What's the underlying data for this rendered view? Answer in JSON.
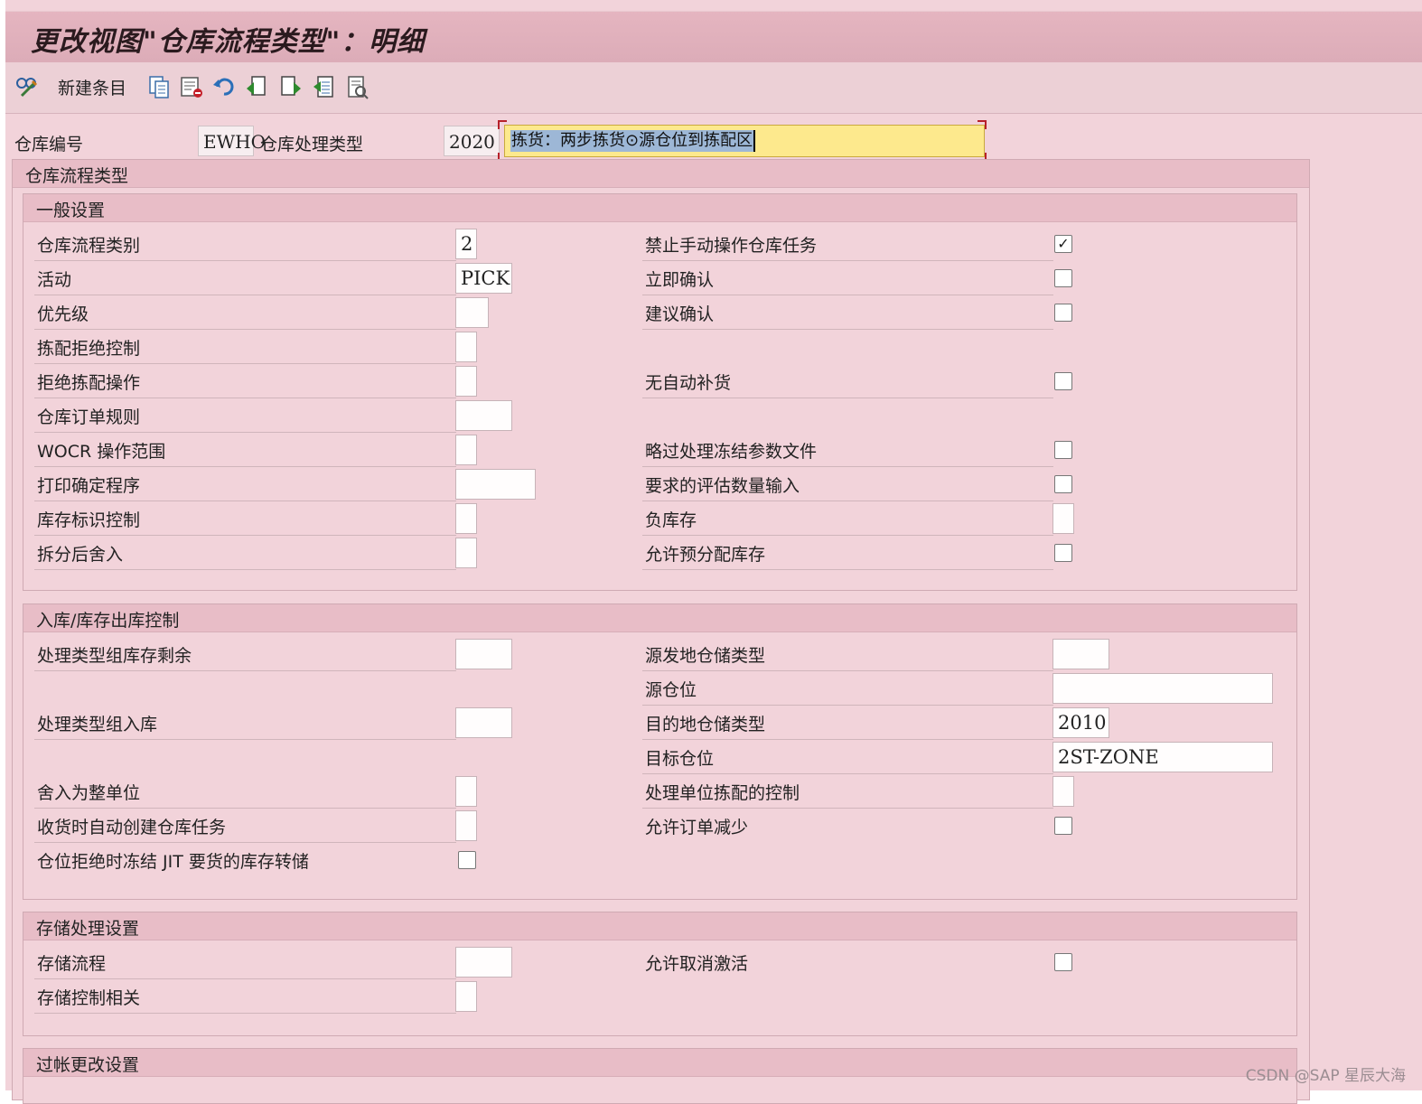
{
  "window": {
    "title": "更改视图\"仓库流程类型\"：明细"
  },
  "toolbar": {
    "new_entry_label": "新建条目",
    "icons": [
      "change-display-icon",
      "copy-icon",
      "delete-icon",
      "undo-icon",
      "prev-entry-icon",
      "next-entry-icon",
      "select-icon",
      "details-icon"
    ]
  },
  "header": {
    "warehouse_label": "仓库编号",
    "warehouse_value": "EWHO",
    "process_type_label": "仓库处理类型",
    "process_type_value": "2020",
    "description_value": "拣货：两步拣货⊙源仓位到拣配区"
  },
  "outer_section": {
    "title": "仓库流程类型"
  },
  "general": {
    "title": "一般设置",
    "left": [
      {
        "label": "仓库流程类别",
        "value": "2"
      },
      {
        "label": "活动",
        "value": "PICK"
      },
      {
        "label": "优先级",
        "value": ""
      },
      {
        "label": "拣配拒绝控制",
        "value": ""
      },
      {
        "label": "拒绝拣配操作",
        "value": ""
      },
      {
        "label": "仓库订单规则",
        "value": ""
      },
      {
        "label": "WOCR 操作范围",
        "value": ""
      },
      {
        "label": "打印确定程序",
        "value": ""
      },
      {
        "label": "库存标识控制",
        "value": ""
      },
      {
        "label": "拆分后舍入",
        "value": ""
      }
    ],
    "right": [
      {
        "label": "禁止手动操作仓库任务",
        "checked": "✓"
      },
      {
        "label": "立即确认",
        "checked": ""
      },
      {
        "label": "建议确认",
        "checked": ""
      },
      {
        "label": "无自动补货",
        "checked": ""
      },
      {
        "label": "略过处理冻结参数文件",
        "checked": ""
      },
      {
        "label": "要求的评估数量输入",
        "checked": ""
      },
      {
        "label": "负库存",
        "value": ""
      },
      {
        "label": "允许预分配库存",
        "checked": ""
      }
    ]
  },
  "inbound": {
    "title": "入库/库存出库控制",
    "left": [
      {
        "label": "处理类型组库存剩余",
        "value": ""
      },
      {
        "label": "处理类型组入库",
        "value": ""
      },
      {
        "label": "舍入为整单位",
        "value": ""
      },
      {
        "label": "收货时自动创建仓库任务",
        "value": ""
      },
      {
        "label": "仓位拒绝时冻结 JIT 要货的库存转储",
        "checked": ""
      }
    ],
    "right": [
      {
        "label": "源发地仓储类型",
        "value": ""
      },
      {
        "label": "源仓位",
        "value": ""
      },
      {
        "label": "目的地仓储类型",
        "value": "2010"
      },
      {
        "label": "目标仓位",
        "value": "2ST-ZONE"
      },
      {
        "label": "处理单位拣配的控制",
        "value": ""
      },
      {
        "label": "允许订单减少",
        "checked": ""
      }
    ]
  },
  "storage": {
    "title": "存储处理设置",
    "left": [
      {
        "label": "存储流程",
        "value": ""
      },
      {
        "label": "存储控制相关",
        "value": ""
      }
    ],
    "right": [
      {
        "label": "允许取消激活",
        "checked": ""
      }
    ]
  },
  "posting": {
    "title": "过帐更改设置"
  },
  "watermark": "CSDN @SAP 星辰大海"
}
